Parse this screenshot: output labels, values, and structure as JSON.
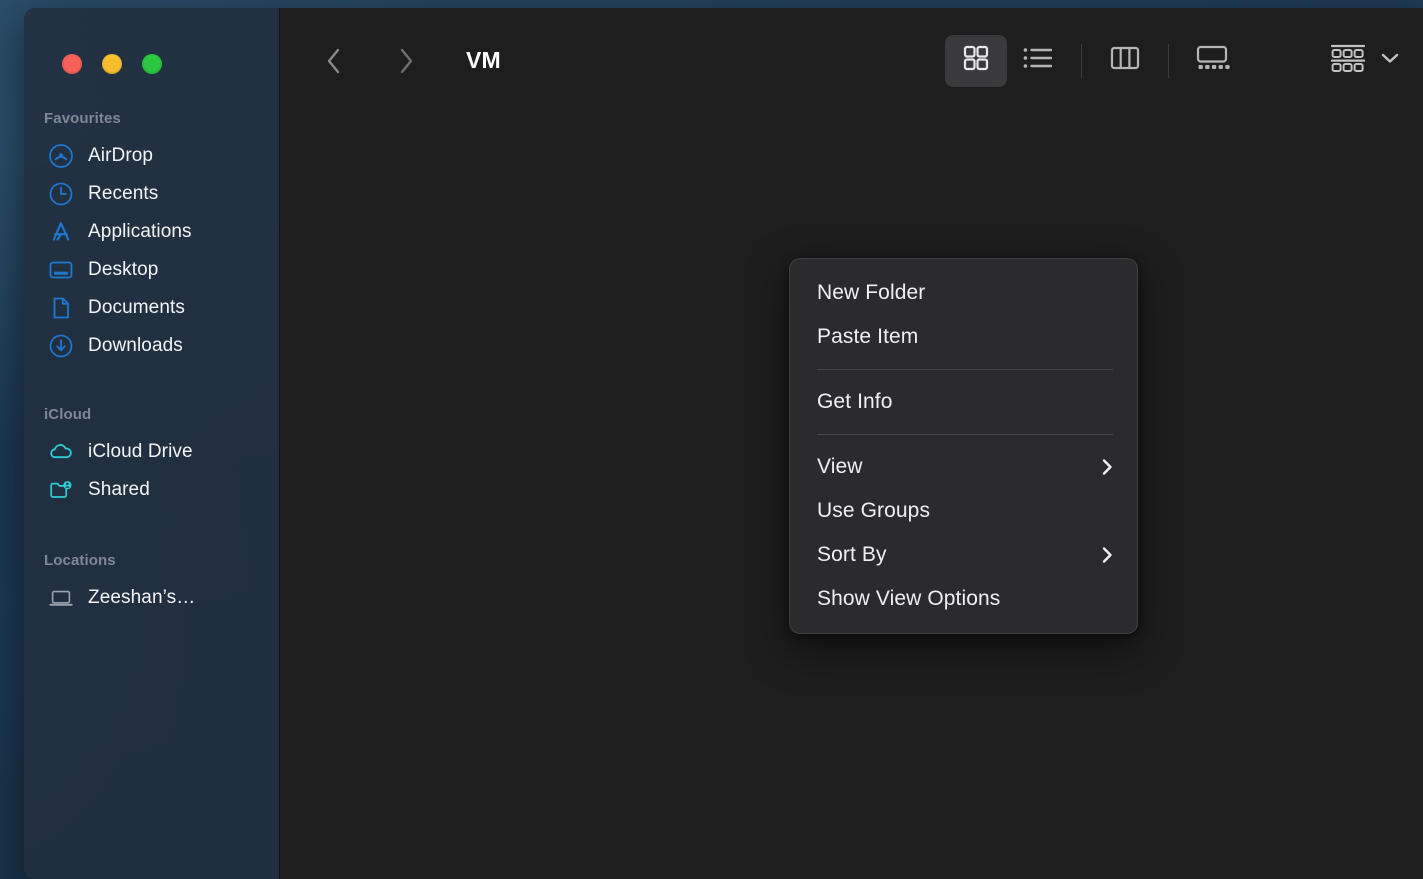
{
  "window": {
    "title": "VM",
    "traffic_lights": [
      {
        "name": "close",
        "color": "#f9615c"
      },
      {
        "name": "minimize",
        "color": "#f7bd2e"
      },
      {
        "name": "maximize",
        "color": "#2bc840"
      }
    ]
  },
  "toolbar": {
    "back_icon": "chevron-left-icon",
    "forward_icon": "chevron-right-icon",
    "view_modes": [
      {
        "id": "icon",
        "icon": "grid-view-icon",
        "active": true
      },
      {
        "id": "list",
        "icon": "list-view-icon",
        "active": false
      },
      {
        "id": "column",
        "icon": "column-view-icon",
        "active": false
      },
      {
        "id": "gallery",
        "icon": "gallery-view-icon",
        "active": false
      }
    ],
    "group_button": {
      "icon": "group-by-icon",
      "chevron": "chevron-down-icon"
    }
  },
  "sidebar": {
    "sections": [
      {
        "header": "Favourites",
        "items": [
          {
            "label": "AirDrop",
            "icon": "airdrop-icon",
            "color": "#1f78d1"
          },
          {
            "label": "Recents",
            "icon": "clock-icon",
            "color": "#1f78d1"
          },
          {
            "label": "Applications",
            "icon": "applications-icon",
            "color": "#1f78d1"
          },
          {
            "label": "Desktop",
            "icon": "desktop-icon",
            "color": "#1f78d1"
          },
          {
            "label": "Documents",
            "icon": "document-icon",
            "color": "#1f78d1"
          },
          {
            "label": "Downloads",
            "icon": "download-icon",
            "color": "#1f78d1"
          }
        ]
      },
      {
        "header": "iCloud",
        "items": [
          {
            "label": "iCloud Drive",
            "icon": "cloud-icon",
            "color": "#2ecfd4"
          },
          {
            "label": "Shared",
            "icon": "shared-folder-icon",
            "color": "#2ecfd4"
          }
        ]
      },
      {
        "header": "Locations",
        "items": [
          {
            "label": "Zeeshan’s…",
            "icon": "laptop-icon",
            "color": "#9aa3ad"
          }
        ]
      }
    ]
  },
  "context_menu": {
    "groups": [
      {
        "items": [
          {
            "label": "New Folder",
            "submenu": false
          },
          {
            "label": "Paste Item",
            "submenu": false
          }
        ]
      },
      {
        "items": [
          {
            "label": "Get Info",
            "submenu": false
          }
        ]
      },
      {
        "items": [
          {
            "label": "View",
            "submenu": true
          },
          {
            "label": "Use Groups",
            "submenu": false
          },
          {
            "label": "Sort By",
            "submenu": true
          },
          {
            "label": "Show View Options",
            "submenu": false
          }
        ]
      }
    ]
  },
  "colors": {
    "sidebar_bg": "#212f40",
    "content_bg": "#1e1e1e",
    "menu_bg": "#2b2b2d",
    "accent_blue": "#1f78d1",
    "accent_cyan": "#2ecfd4"
  }
}
